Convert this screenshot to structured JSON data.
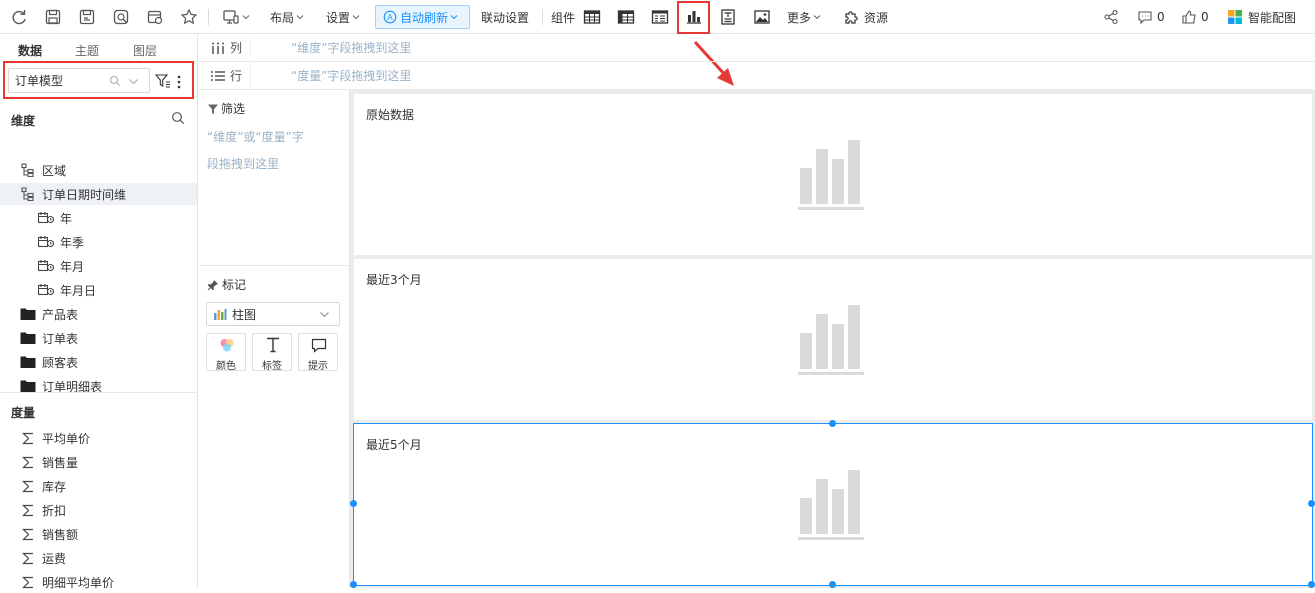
{
  "toolbar": {
    "layout_label": "布局",
    "settings_label": "设置",
    "auto_refresh_label": "自动刷新",
    "link_settings_label": "联动设置",
    "components_label": "组件",
    "more_label": "更多",
    "resources_label": "资源",
    "comment_count": "0",
    "like_count": "0",
    "smart_color_label": "智能配图"
  },
  "left_panel": {
    "tabs": [
      "数据",
      "主题",
      "图层"
    ],
    "model_select": "订单模型",
    "dimensions_title": "维度",
    "dimensions": [
      {
        "label": "区域",
        "icon": "hierarchy-icon",
        "indent": 0
      },
      {
        "label": "订单日期时间维",
        "icon": "hierarchy-icon",
        "indent": 0
      },
      {
        "label": "年",
        "icon": "date-icon",
        "indent": 1
      },
      {
        "label": "年季",
        "icon": "date-icon",
        "indent": 1
      },
      {
        "label": "年月",
        "icon": "date-icon",
        "indent": 1
      },
      {
        "label": "年月日",
        "icon": "date-icon",
        "indent": 1
      },
      {
        "label": "产品表",
        "icon": "folder-icon",
        "indent": 0
      },
      {
        "label": "订单表",
        "icon": "folder-icon",
        "indent": 0
      },
      {
        "label": "顾客表",
        "icon": "folder-icon",
        "indent": 0
      },
      {
        "label": "订单明细表",
        "icon": "folder-icon",
        "indent": 0
      }
    ],
    "measures_title": "度量",
    "measures": [
      "平均单价",
      "销售量",
      "库存",
      "折扣",
      "销售额",
      "运费",
      "明细平均单价"
    ]
  },
  "shelves": {
    "columns_label": "列",
    "columns_placeholder": "“维度”字段拖拽到这里",
    "rows_label": "行",
    "rows_placeholder": "“度量”字段拖拽到这里"
  },
  "card_panel": {
    "filter_label": "筛选",
    "filter_placeholder_1": "“维度”或“度量”字",
    "filter_placeholder_2": "段拖拽到这里",
    "marks_label": "标记",
    "chart_type": "柱图",
    "mark_buttons": [
      "颜色",
      "标签",
      "提示"
    ]
  },
  "widgets": [
    {
      "title": "原始数据"
    },
    {
      "title": "最近3个月"
    },
    {
      "title": "最近5个月"
    }
  ],
  "colors": {
    "accent": "#1890ff",
    "highlight": "#e53935",
    "placeholder_chart": "#d9d9d9"
  }
}
